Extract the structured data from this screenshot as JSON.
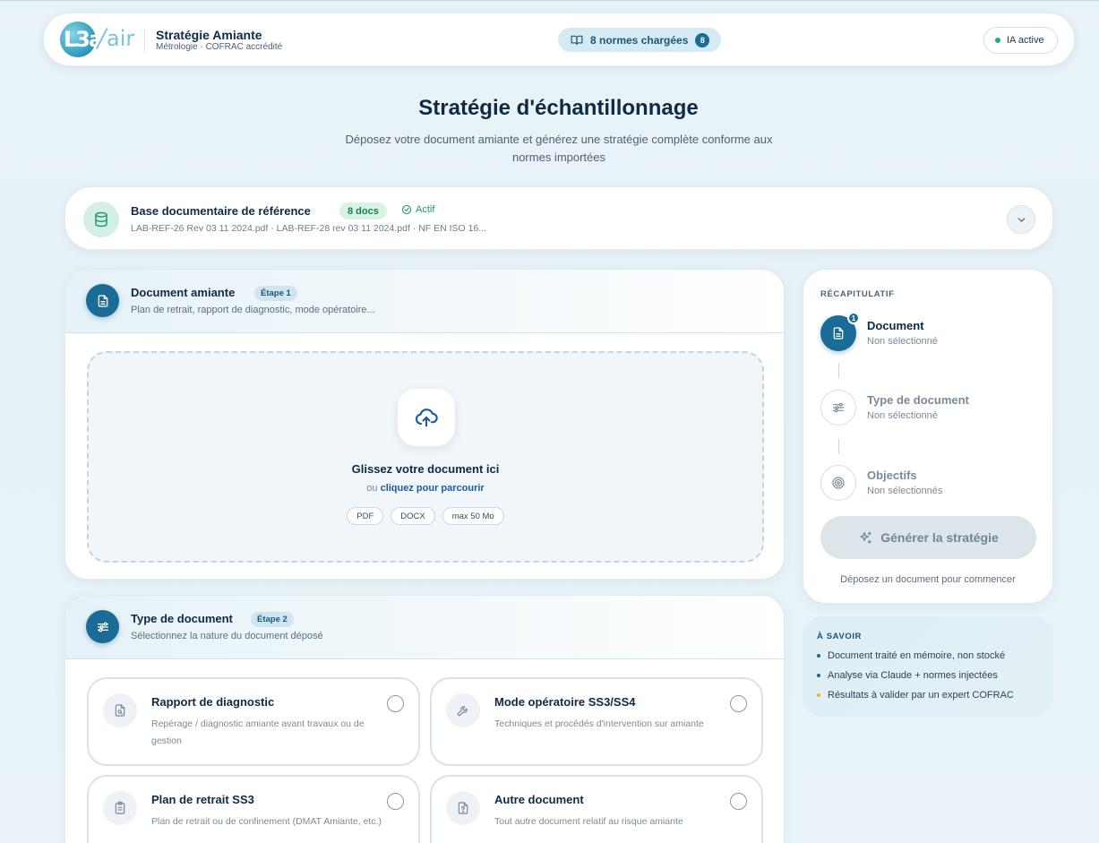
{
  "header": {
    "logo_text": "L3a/air",
    "app_title": "Stratégie Amiante",
    "app_subtitle": "Métrologie · COFRAC accrédité",
    "norms_label": "8 normes chargées",
    "norms_count": "8",
    "ia_status": "IA active"
  },
  "page": {
    "title": "Stratégie d'échantillonnage",
    "subtitle": "Déposez votre document amiante et générez une stratégie complète conforme aux normes importées"
  },
  "reference_base": {
    "title": "Base documentaire de référence",
    "docs_badge": "8 docs",
    "status": "Actif",
    "files": "LAB-REF-26 Rev 03 11 2024.pdf · LAB-REF-28 rev 03 11 2024.pdf · NF EN ISO 16..."
  },
  "step1": {
    "title": "Document amiante",
    "badge": "Étape 1",
    "subtitle": "Plan de retrait, rapport de diagnostic, mode opératoire...",
    "dropzone": {
      "title": "Glissez votre document ici",
      "or_text": "ou ",
      "browse_link": "cliquez pour parcourir",
      "formats": [
        "PDF",
        "DOCX",
        "max 50 Mo"
      ]
    }
  },
  "step2": {
    "title": "Type de document",
    "badge": "Étape 2",
    "subtitle": "Sélectionnez la nature du document déposé",
    "options": [
      {
        "title": "Rapport de diagnostic",
        "desc": "Repérage / diagnostic amiante avant travaux ou de gestion",
        "icon": "file-search-icon"
      },
      {
        "title": "Mode opératoire SS3/SS4",
        "desc": "Techniques et procédés d'intervention sur amiante",
        "icon": "wrench-icon"
      },
      {
        "title": "Plan de retrait SS3",
        "desc": "Plan de retrait ou de confinement (DMAT Amiante, etc.)",
        "icon": "clipboard-icon"
      },
      {
        "title": "Autre document",
        "desc": "Tout autre document relatif au risque amiante",
        "icon": "file-question-icon"
      }
    ]
  },
  "recap": {
    "heading": "RÉCAPITULATIF",
    "steps": [
      {
        "title": "Document",
        "status": "Non sélectionné",
        "badge": "1"
      },
      {
        "title": "Type de document",
        "status": "Non sélectionné"
      },
      {
        "title": "Objectifs",
        "status": "Non sélectionnés"
      }
    ],
    "generate_label": "Générer la stratégie",
    "hint": "Déposez un document pour commencer"
  },
  "info": {
    "heading": "À SAVOIR",
    "items": [
      {
        "text": "Document traité en mémoire, non stocké",
        "color": "#1a6b95"
      },
      {
        "text": "Analyse via Claude + normes injectées",
        "color": "#1a6b95"
      },
      {
        "text": "Résultats à valider par un expert COFRAC",
        "color": "#f0b429"
      }
    ]
  }
}
